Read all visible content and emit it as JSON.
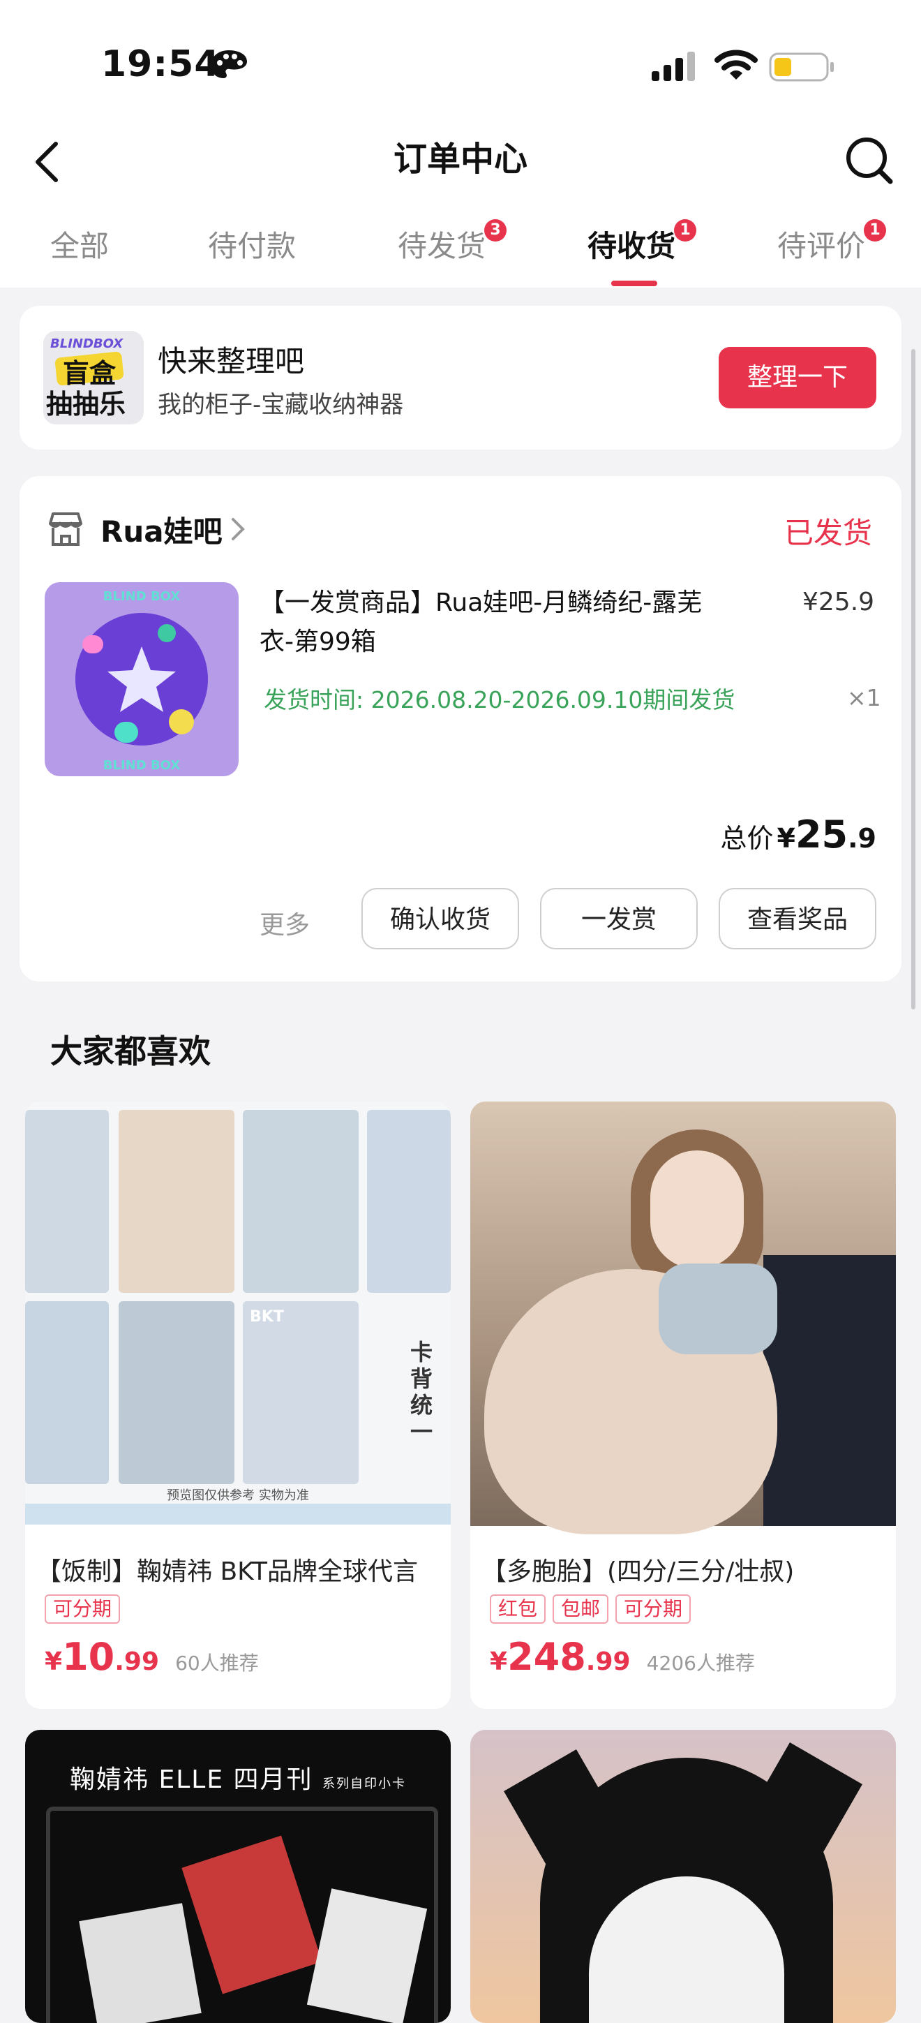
{
  "status_bar": {
    "time": "19:54"
  },
  "nav": {
    "title": "订单中心"
  },
  "tabs": [
    {
      "label": "全部",
      "badge": ""
    },
    {
      "label": "待付款",
      "badge": ""
    },
    {
      "label": "待发货",
      "badge": "3"
    },
    {
      "label": "待收货",
      "badge": "1",
      "active": true
    },
    {
      "label": "待评价",
      "badge": "1"
    }
  ],
  "promo": {
    "icon_text_top": "BLINDBOX",
    "icon_text_line1": "盲盒",
    "icon_text_line2": "抽抽乐",
    "title": "快来整理吧",
    "subtitle": "我的柜子-宝藏收纳神器",
    "button": "整理一下"
  },
  "order": {
    "store_name": "Rua娃吧",
    "status": "已发货",
    "product": {
      "image_text_top": "BLIND BOX",
      "image_text_bottom": "BLIND BOX",
      "title": "【一发赏商品】Rua娃吧-月鳞绮纪-露芜衣-第99箱",
      "price": "¥25.9",
      "ship_time": "发货时间: 2026.08.20-2026.09.10期间发货",
      "qty": "×1"
    },
    "total": {
      "label": "总价",
      "symbol": "¥",
      "int": "25",
      "dec": ".9"
    },
    "more": "更多",
    "buttons": [
      "确认收货",
      "一发赏",
      "查看奖品"
    ]
  },
  "recommend": {
    "title": "大家都喜欢",
    "items": [
      {
        "image_caption": "预览图仅供参考 实物为准",
        "image_side_text": "卡背统一",
        "image_brand": "BKT",
        "title": "【饭制】鞠婧祎 BKT品牌全球代言",
        "tags": [
          "可分期"
        ],
        "price_symbol": "¥",
        "price_int": "10",
        "price_dec": ".99",
        "recommend": "60人推荐"
      },
      {
        "title": "【多胞胎】(四分/三分/壮叔)",
        "tags": [
          "红包",
          "包邮",
          "可分期"
        ],
        "price_symbol": "¥",
        "price_int": "248",
        "price_dec": ".99",
        "recommend": "4206人推荐"
      },
      {
        "image_header": "鞠婧祎 ELLE 四月刊",
        "image_header_small": "系列自印小卡"
      },
      {}
    ]
  },
  "colors": {
    "accent": "#e8334d",
    "ship_green": "#3aa35a",
    "background": "#f3f3f5"
  },
  "icons": [
    "palette-icon",
    "signal-icon",
    "wifi-icon",
    "battery-icon",
    "back-icon",
    "search-icon",
    "store-icon",
    "chevron-right-icon"
  ]
}
